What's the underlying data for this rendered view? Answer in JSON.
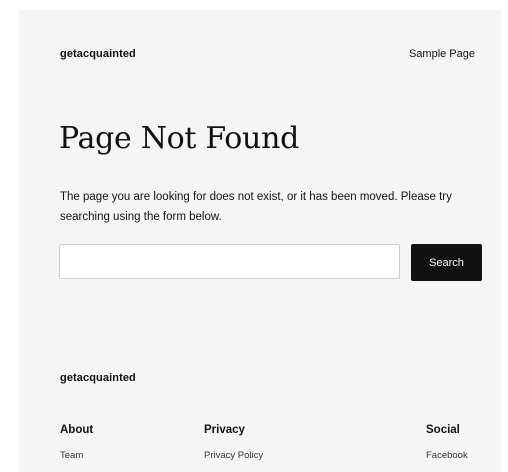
{
  "header": {
    "site_title": "getacquainted",
    "nav_link": "Sample Page"
  },
  "main": {
    "heading": "Page Not Found",
    "message": "The page you are looking for does not exist, or it has been moved. Please try searching using the form below.",
    "search": {
      "value": "",
      "placeholder": "",
      "button_label": "Search"
    }
  },
  "footer": {
    "site_title": "getacquainted",
    "columns": [
      {
        "heading": "About",
        "links": [
          "Team"
        ]
      },
      {
        "heading": "Privacy",
        "links": [
          "Privacy Policy"
        ]
      },
      {
        "heading": "Social",
        "links": [
          "Facebook"
        ]
      }
    ]
  },
  "colors": {
    "page_background": "#f5f5f5",
    "button_background": "#111111",
    "text": "#111111"
  }
}
